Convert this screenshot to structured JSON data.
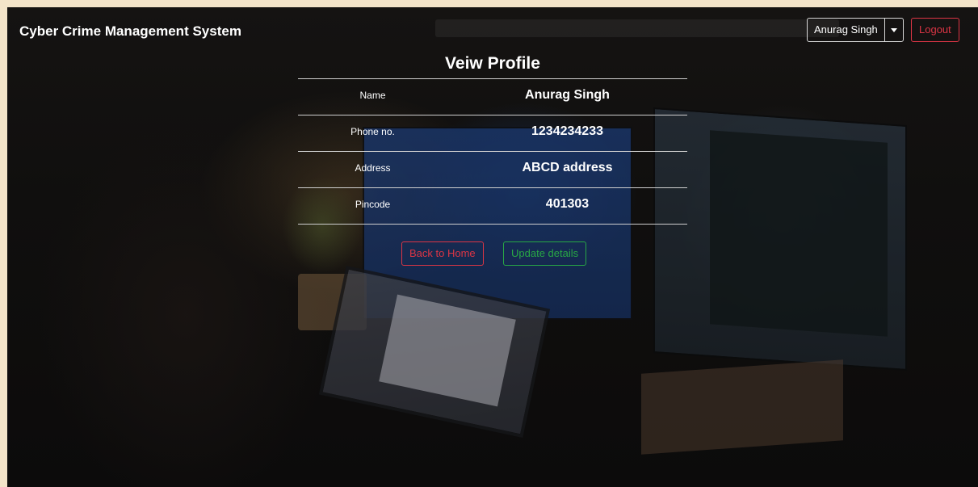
{
  "navbar": {
    "brand": "Cyber Crime Management System",
    "user_name": "Anurag Singh",
    "logout_label": "Logout"
  },
  "profile": {
    "title": "Veiw Profile",
    "rows": [
      {
        "label": "Name",
        "value": "Anurag Singh"
      },
      {
        "label": "Phone no.",
        "value": "1234234233"
      },
      {
        "label": "Address",
        "value": "ABCD address"
      },
      {
        "label": "Pincode",
        "value": "401303"
      }
    ],
    "back_label": "Back to Home",
    "update_label": "Update details"
  },
  "colors": {
    "danger": "#dc3545",
    "success": "#28a745",
    "page_border": "#f3e4c9"
  }
}
